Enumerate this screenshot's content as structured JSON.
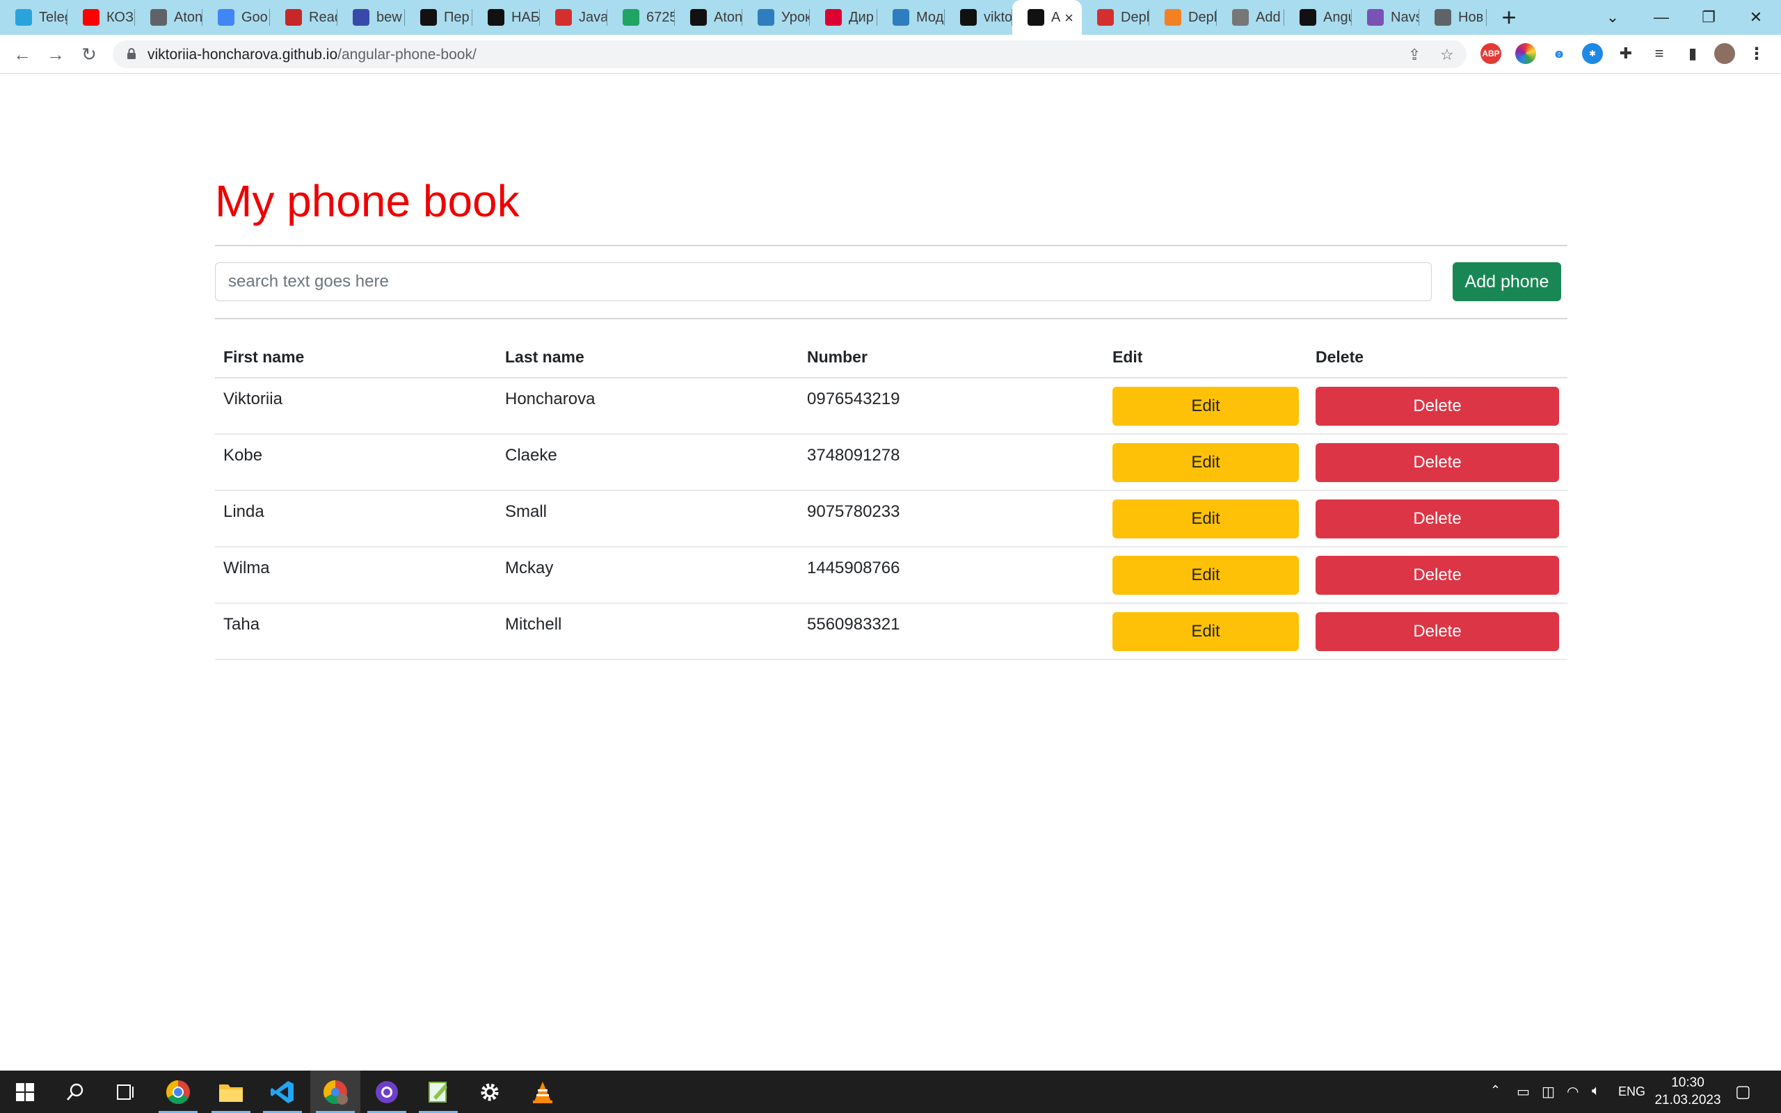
{
  "browser": {
    "tabs": [
      {
        "label": "Teleg",
        "icon": "telegram-icon",
        "color": "#2aa3dd"
      },
      {
        "label": "КОЗ",
        "icon": "youtube-icon",
        "color": "#ff0000"
      },
      {
        "label": "Aton",
        "icon": "globe-icon",
        "color": "#5f6368"
      },
      {
        "label": "Goo",
        "icon": "google-translate-icon",
        "color": "#4285f4"
      },
      {
        "label": "Read",
        "icon": "book-icon",
        "color": "#c62828"
      },
      {
        "label": "bew",
        "icon": "app-icon",
        "color": "#3949ab"
      },
      {
        "label": "Пер",
        "icon": "dou-icon",
        "color": "#111111"
      },
      {
        "label": "НАБ",
        "icon": "dou-icon",
        "color": "#111111"
      },
      {
        "label": "Java",
        "icon": "javarush-icon",
        "color": "#d32f2f"
      },
      {
        "label": "6725",
        "icon": "google-drive-icon",
        "color": "#1fa463"
      },
      {
        "label": "Aton",
        "icon": "jc-icon",
        "color": "#111111"
      },
      {
        "label": "Урок",
        "icon": "course-icon",
        "color": "#2e7dbe"
      },
      {
        "label": "Дир",
        "icon": "angular-icon",
        "color": "#dd0031"
      },
      {
        "label": "Мод",
        "icon": "course-icon",
        "color": "#2e7dbe"
      },
      {
        "label": "vikto",
        "icon": "github-icon",
        "color": "#111111"
      },
      {
        "label": "A",
        "icon": "angular-icon",
        "color": "#111111",
        "active": true
      },
      {
        "label": "Depl",
        "icon": "heroku-icon",
        "color": "#d32f2f"
      },
      {
        "label": "Depl",
        "icon": "stackoverflow-icon",
        "color": "#f48024"
      },
      {
        "label": "Add",
        "icon": "docs-icon",
        "color": "#777777"
      },
      {
        "label": "Angu",
        "icon": "angular-icon",
        "color": "#111111"
      },
      {
        "label": "Navs",
        "icon": "bootstrap-icon",
        "color": "#7952b3"
      },
      {
        "label": "Нов",
        "icon": "globe-icon",
        "color": "#5f6368"
      }
    ],
    "url_host": "viktoriia-honcharova.github.io",
    "url_path": "/angular-phone-book/"
  },
  "page": {
    "title": "My phone book",
    "search_placeholder": "search text goes here",
    "add_button": "Add phone",
    "table": {
      "headers": [
        "First name",
        "Last name",
        "Number",
        "Edit",
        "Delete"
      ],
      "edit_label": "Edit",
      "delete_label": "Delete",
      "rows": [
        {
          "first": "Viktoriia",
          "last": "Honcharova",
          "number": "0976543219"
        },
        {
          "first": "Kobe",
          "last": "Claeke",
          "number": "3748091278"
        },
        {
          "first": "Linda",
          "last": "Small",
          "number": "9075780233"
        },
        {
          "first": "Wilma",
          "last": "Mckay",
          "number": "1445908766"
        },
        {
          "first": "Taha",
          "last": "Mitchell",
          "number": "5560983321"
        }
      ]
    }
  },
  "taskbar": {
    "language": "ENG",
    "time": "10:30",
    "date": "21.03.2023"
  },
  "colors": {
    "title": "#ee0000",
    "add_button": "#198754",
    "edit_button": "#ffc107",
    "delete_button": "#dc3545",
    "tabstrip": "#a9dcee"
  }
}
